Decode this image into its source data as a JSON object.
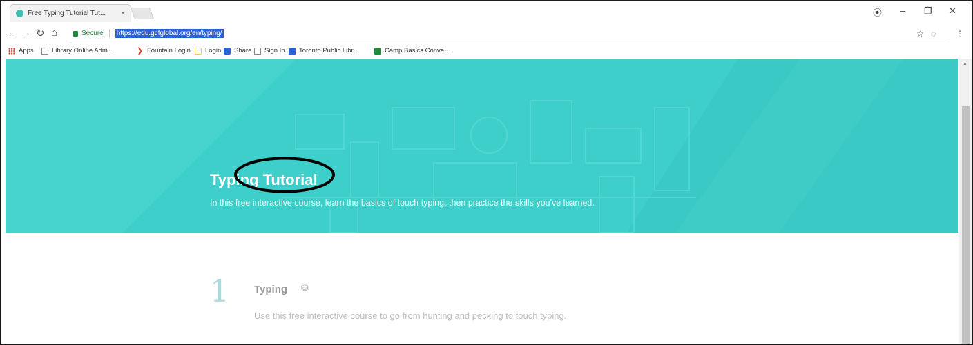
{
  "browser": {
    "tab_title": "Free Typing Tutorial Tut...",
    "tab_close": "×",
    "window_controls": {
      "account": "⦿",
      "minimize": "–",
      "restore": "❐",
      "close": "✕"
    },
    "nav": {
      "back": "←",
      "forward": "→",
      "reload": "↻",
      "home": "⌂"
    },
    "security_label": "Secure",
    "url": "https://edu.gcfglobal.org/en/typing/",
    "star": "☆",
    "menu": "⋮",
    "extension": "◌"
  },
  "bookmarks": [
    {
      "label": "Apps",
      "icon": "apps-grid-icon",
      "color": "#e04a3a"
    },
    {
      "label": "Library Online Adm...",
      "icon": "page-icon",
      "color": "#888888"
    },
    {
      "label": "Fountain Login",
      "icon": "chevron-icon",
      "color": "#e0452b"
    },
    {
      "label": "Login",
      "icon": "login-icon",
      "color": "#f2c94c"
    },
    {
      "label": "Share",
      "icon": "share-icon",
      "color": "#2a63d8"
    },
    {
      "label": "Sign In",
      "icon": "page-icon",
      "color": "#888888"
    },
    {
      "label": "Toronto Public Libr...",
      "icon": "library-icon",
      "color": "#2a63d8"
    },
    {
      "label": "Camp Basics Conve...",
      "icon": "sheets-icon",
      "color": "#1f8b3a"
    }
  ],
  "hero": {
    "title": "Typing Tutorial",
    "subtitle": "In this free interactive course, learn the basics of touch typing, then practice the skills you've learned.",
    "background": "#3fcfca"
  },
  "lesson": {
    "number": "1",
    "title": "Typing",
    "icon": "keyboard-icon",
    "description": "Use this free interactive course to go from hunting and pecking to touch typing."
  }
}
